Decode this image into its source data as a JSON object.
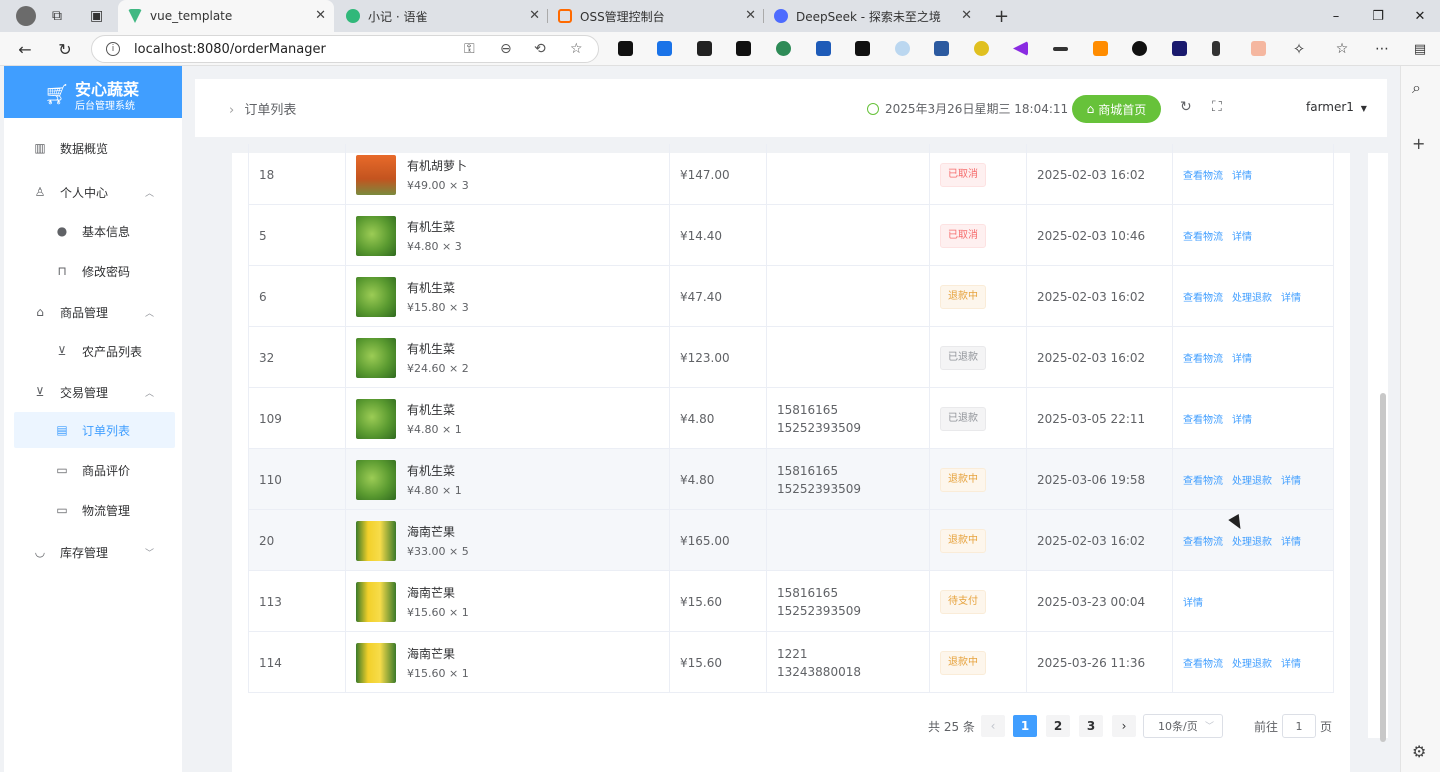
{
  "browser": {
    "tabs": [
      {
        "title": "vue_template",
        "color": "#41b883"
      },
      {
        "title": "小记 · 语雀",
        "color": "#31b87a"
      },
      {
        "title": "OSS管理控制台",
        "color": "#ff6a00"
      },
      {
        "title": "DeepSeek - 探索未至之境",
        "color": "#4d6bfe"
      }
    ],
    "url": "localhost:8080/orderManager",
    "window_controls": {
      "minimize": "–",
      "restore": "❐",
      "close": "✕"
    }
  },
  "sidebar": {
    "brand_title": "安心蔬菜",
    "brand_subtitle": "后台管理系统",
    "items": [
      {
        "label": "数据概览",
        "icon": "bar-chart-icon"
      },
      {
        "label": "个人中心",
        "icon": "user-icon"
      },
      {
        "label": "基本信息",
        "icon": "info-icon"
      },
      {
        "label": "修改密码",
        "icon": "lock-icon"
      },
      {
        "label": "商品管理",
        "icon": "shop-icon"
      },
      {
        "label": "农产品列表",
        "icon": "cart-icon"
      },
      {
        "label": "交易管理",
        "icon": "cart-icon"
      },
      {
        "label": "订单列表",
        "icon": "document-icon"
      },
      {
        "label": "商品评价",
        "icon": "comment-icon"
      },
      {
        "label": "物流管理",
        "icon": "truck-icon"
      },
      {
        "label": "库存管理",
        "icon": "stock-icon"
      }
    ]
  },
  "header": {
    "breadcrumb": "订单列表",
    "datetime": "2025年3月26日星期三 18:04:11",
    "mall_button": "商城首页",
    "user": "farmer1"
  },
  "table": {
    "rows": [
      {
        "id": "18",
        "product": "有机胡萝卜",
        "unit": "¥49.00 × 3",
        "img": "carrot",
        "total": "¥147.00",
        "phone1": "",
        "phone2": "",
        "status": "已取消",
        "status_type": "danger",
        "time": "2025-02-03 16:02",
        "actions": [
          "查看物流",
          "详情"
        ]
      },
      {
        "id": "5",
        "product": "有机生菜",
        "unit": "¥4.80 × 3",
        "img": "lettuce",
        "total": "¥14.40",
        "phone1": "",
        "phone2": "",
        "status": "已取消",
        "status_type": "danger",
        "time": "2025-02-03 10:46",
        "actions": [
          "查看物流",
          "详情"
        ]
      },
      {
        "id": "6",
        "product": "有机生菜",
        "unit": "¥15.80 × 3",
        "img": "lettuce",
        "total": "¥47.40",
        "phone1": "",
        "phone2": "",
        "status": "退款中",
        "status_type": "warning",
        "time": "2025-02-03 16:02",
        "actions": [
          "查看物流",
          "处理退款",
          "详情"
        ]
      },
      {
        "id": "32",
        "product": "有机生菜",
        "unit": "¥24.60 × 2",
        "img": "lettuce",
        "total": "¥123.00",
        "phone1": "",
        "phone2": "",
        "status": "已退款",
        "status_type": "info",
        "time": "2025-02-03 16:02",
        "actions": [
          "查看物流",
          "详情"
        ]
      },
      {
        "id": "109",
        "product": "有机生菜",
        "unit": "¥4.80 × 1",
        "img": "lettuce",
        "total": "¥4.80",
        "phone1": "15816165",
        "phone2": "15252393509",
        "status": "已退款",
        "status_type": "info",
        "time": "2025-03-05 22:11",
        "actions": [
          "查看物流",
          "详情"
        ]
      },
      {
        "id": "110",
        "product": "有机生菜",
        "unit": "¥4.80 × 1",
        "img": "lettuce",
        "total": "¥4.80",
        "phone1": "15816165",
        "phone2": "15252393509",
        "status": "退款中",
        "status_type": "warning",
        "time": "2025-03-06 19:58",
        "actions": [
          "查看物流",
          "处理退款",
          "详情"
        ]
      },
      {
        "id": "20",
        "product": "海南芒果",
        "unit": "¥33.00 × 5",
        "img": "mango",
        "total": "¥165.00",
        "phone1": "",
        "phone2": "",
        "status": "退款中",
        "status_type": "warning",
        "time": "2025-02-03 16:02",
        "actions": [
          "查看物流",
          "处理退款",
          "详情"
        ]
      },
      {
        "id": "113",
        "product": "海南芒果",
        "unit": "¥15.60 × 1",
        "img": "mango",
        "total": "¥15.60",
        "phone1": "15816165",
        "phone2": "15252393509",
        "status": "待支付",
        "status_type": "warning",
        "time": "2025-03-23 00:04",
        "actions": [
          "详情"
        ]
      },
      {
        "id": "114",
        "product": "海南芒果",
        "unit": "¥15.60 × 1",
        "img": "mango",
        "total": "¥15.60",
        "phone1": "1221",
        "phone2": "13243880018",
        "status": "退款中",
        "status_type": "warning",
        "time": "2025-03-26 11:36",
        "actions": [
          "查看物流",
          "处理退款",
          "详情"
        ]
      }
    ]
  },
  "pagination": {
    "total_text": "共 25 条",
    "pages": [
      "1",
      "2",
      "3"
    ],
    "current": "1",
    "page_size": "10条/页",
    "goto_label": "前往",
    "goto_value": "1",
    "page_suffix": "页"
  },
  "colors": {
    "primary": "#409eff",
    "success": "#67c23a",
    "danger": "#f56c6c",
    "warning": "#e6a23c"
  }
}
